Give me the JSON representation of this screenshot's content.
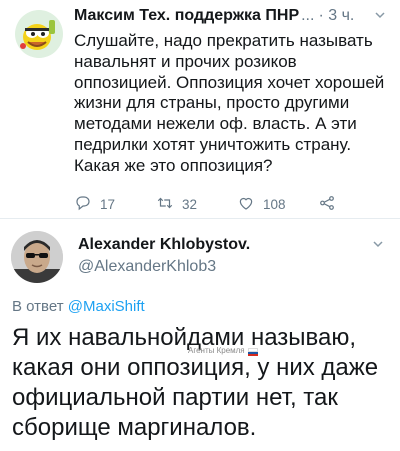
{
  "tweet1": {
    "author_name": "Максим Тех. поддержка ПНР",
    "ellipsis": "...",
    "time": "· 3 ч.",
    "text": "Слушайте, надо прекратить называть навальнят и прочих розиков оппозицией. Оппозиция хочет хорошей жизни для страны, просто другими методами нежели оф. власть. А эти педрилки хотят уничтожить страну. Какая же это оппозиция?",
    "replies": "17",
    "retweets": "32",
    "likes": "108",
    "avatar_icon": "cartoon-face-avatar"
  },
  "tweet2": {
    "author_name": "Alexander Khlobystov.",
    "handle": "@AlexanderKhlob3",
    "reply_prefix": "В ответ",
    "reply_mention": "@MaxiShift",
    "text": "Я их навальнойдами называю, какая они оппозиция, у них даже официальной партии нет, так сборище маргиналов.",
    "avatar_icon": "man-with-sunglasses-avatar"
  },
  "watermark": {
    "text": "Агенты Кремля",
    "flag_colors": [
      "#ffffff",
      "#1c57a5",
      "#d52b1e"
    ]
  },
  "colors": {
    "text": "#14171a",
    "muted": "#657786",
    "link": "#1da1f2",
    "divider": "#e6ecf0"
  }
}
